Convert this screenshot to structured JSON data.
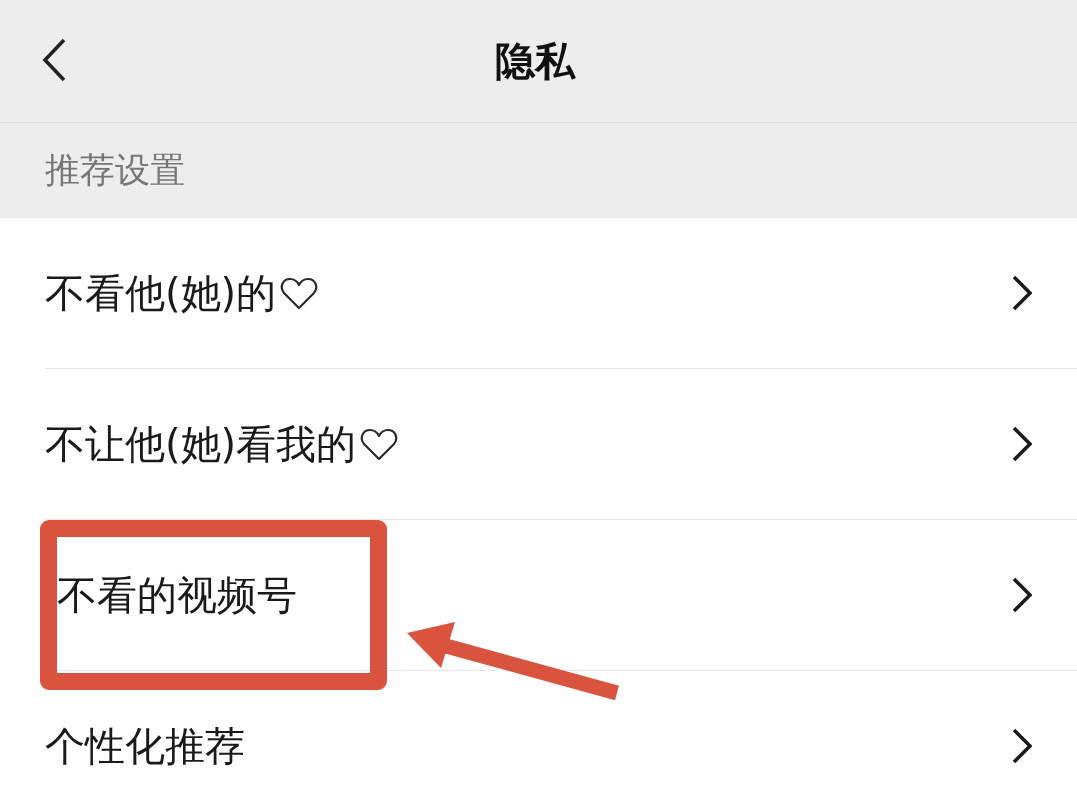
{
  "header": {
    "title": "隐私"
  },
  "section": {
    "title": "推荐设置"
  },
  "items": [
    {
      "label": "不看他(她)的",
      "heart": true,
      "highlighted": false
    },
    {
      "label": "不让他(她)看我的",
      "heart": true,
      "highlighted": false
    },
    {
      "label": "不看的视频号",
      "heart": false,
      "highlighted": true
    },
    {
      "label": "个性化推荐",
      "heart": false,
      "highlighted": false
    }
  ]
}
